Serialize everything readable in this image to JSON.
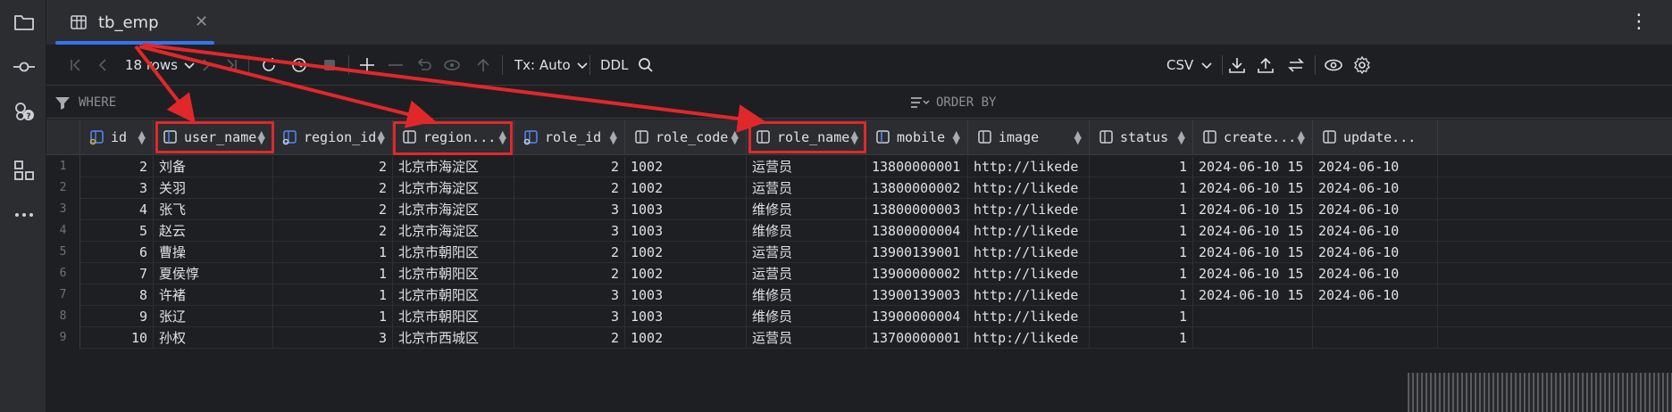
{
  "tab": {
    "title": "tb_emp"
  },
  "toolbar": {
    "rows_label": "18 rows",
    "tx_label": "Tx: Auto",
    "ddl_label": "DDL",
    "export_format": "CSV"
  },
  "filter": {
    "where_label": "WHERE",
    "orderby_label": "ORDER BY"
  },
  "columns": [
    {
      "name": "id",
      "icon": "primary-key-icon"
    },
    {
      "name": "user_name",
      "icon": "column-index-icon"
    },
    {
      "name": "region_id",
      "icon": "foreign-key-icon"
    },
    {
      "name": "region...",
      "icon": "column-icon"
    },
    {
      "name": "role_id",
      "icon": "foreign-key-icon"
    },
    {
      "name": "role_code",
      "icon": "column-icon"
    },
    {
      "name": "role_name",
      "icon": "column-icon"
    },
    {
      "name": "mobile",
      "icon": "column-index-icon"
    },
    {
      "name": "image",
      "icon": "column-icon"
    },
    {
      "name": "status",
      "icon": "column-icon"
    },
    {
      "name": "create...",
      "icon": "column-icon"
    },
    {
      "name": "update...",
      "icon": "column-icon"
    }
  ],
  "rows": [
    [
      "1",
      "2",
      "刘备",
      "2",
      "北京市海淀区",
      "2",
      "1002",
      "运营员",
      "13800000001",
      "http://likede",
      "1",
      "2024-06-10 15",
      "2024-06-10"
    ],
    [
      "2",
      "3",
      "关羽",
      "2",
      "北京市海淀区",
      "2",
      "1002",
      "运营员",
      "13800000002",
      "http://likede",
      "1",
      "2024-06-10 15",
      "2024-06-10"
    ],
    [
      "3",
      "4",
      "张飞",
      "2",
      "北京市海淀区",
      "3",
      "1003",
      "维修员",
      "13800000003",
      "http://likede",
      "1",
      "2024-06-10 15",
      "2024-06-10"
    ],
    [
      "4",
      "5",
      "赵云",
      "2",
      "北京市海淀区",
      "3",
      "1003",
      "维修员",
      "13800000004",
      "http://likede",
      "1",
      "2024-06-10 15",
      "2024-06-10"
    ],
    [
      "5",
      "6",
      "曹操",
      "1",
      "北京市朝阳区",
      "2",
      "1002",
      "运营员",
      "13900139001",
      "http://likede",
      "1",
      "2024-06-10 15",
      "2024-06-10"
    ],
    [
      "6",
      "7",
      "夏侯惇",
      "1",
      "北京市朝阳区",
      "2",
      "1002",
      "运营员",
      "13900000002",
      "http://likede",
      "1",
      "2024-06-10 15",
      "2024-06-10"
    ],
    [
      "7",
      "8",
      "许褚",
      "1",
      "北京市朝阳区",
      "3",
      "1003",
      "维修员",
      "13900139003",
      "http://likede",
      "1",
      "2024-06-10 15",
      "2024-06-10"
    ],
    [
      "8",
      "9",
      "张辽",
      "1",
      "北京市朝阳区",
      "3",
      "1003",
      "维修员",
      "13900000004",
      "http://likede",
      "1",
      "",
      ""
    ],
    [
      "9",
      "10",
      "孙权",
      "3",
      "北京市西城区",
      "2",
      "1002",
      "运营员",
      "13700000001",
      "http://likede",
      "1",
      "",
      ""
    ]
  ],
  "colors": {
    "accent": "#3574f0",
    "highlight": "#e0282a",
    "background": "#1e1f22",
    "panel": "#2b2d30"
  }
}
